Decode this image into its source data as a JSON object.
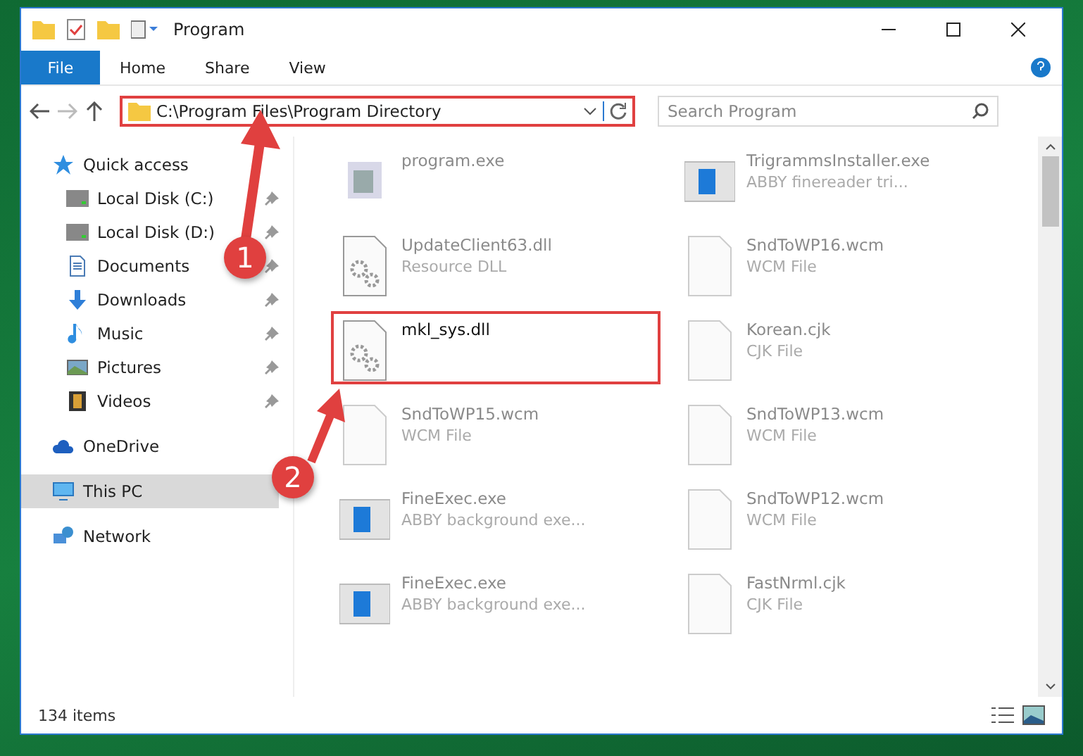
{
  "window": {
    "title": "Program"
  },
  "ribbon_tabs": [
    {
      "label": "File",
      "selected": true
    },
    {
      "label": "Home",
      "selected": false
    },
    {
      "label": "Share",
      "selected": false
    },
    {
      "label": "View",
      "selected": false
    }
  ],
  "address_bar": {
    "path": "C:\\Program Files\\Program Directory",
    "highlighted": true
  },
  "search": {
    "placeholder": "Search Program"
  },
  "sidebar": {
    "items": [
      {
        "label": "Quick access",
        "kind": "star",
        "pinned": false,
        "selected": false,
        "children": [
          {
            "label": "Local Disk (C:)",
            "kind": "drive",
            "pinned": true,
            "selected": false
          },
          {
            "label": "Local Disk (D:)",
            "kind": "drive",
            "pinned": true,
            "selected": false
          },
          {
            "label": "Documents",
            "kind": "documents",
            "pinned": true,
            "selected": false
          },
          {
            "label": "Downloads",
            "kind": "downloads",
            "pinned": true,
            "selected": false
          },
          {
            "label": "Music",
            "kind": "music",
            "pinned": true,
            "selected": false
          },
          {
            "label": "Pictures",
            "kind": "pictures",
            "pinned": true,
            "selected": false
          },
          {
            "label": "Videos",
            "kind": "videos",
            "pinned": true,
            "selected": false
          }
        ]
      },
      {
        "label": "OneDrive",
        "kind": "cloud",
        "pinned": false,
        "selected": false
      },
      {
        "label": "This PC",
        "kind": "pc",
        "pinned": false,
        "selected": true
      },
      {
        "label": "Network",
        "kind": "network",
        "pinned": false,
        "selected": false
      }
    ]
  },
  "files": [
    {
      "name": "program.exe",
      "kind": "program",
      "highlighted": false
    },
    {
      "name": "TrigrammsInstaller.exe",
      "type": "ABBY finereader tri...",
      "kind": "app",
      "highlighted": false
    },
    {
      "name": "UpdateClient63.dll",
      "type": "Resource DLL",
      "kind": "dll",
      "highlighted": false
    },
    {
      "name": "SndToWP16.wcm",
      "type": "WCM File",
      "kind": "document",
      "highlighted": false
    },
    {
      "name": "mkl_sys.dll",
      "kind": "dll",
      "highlighted": true
    },
    {
      "name": "Korean.cjk",
      "type": "CJK File",
      "kind": "document",
      "highlighted": false
    },
    {
      "name": "SndToWP15.wcm",
      "type": "WCM File",
      "kind": "document",
      "highlighted": false
    },
    {
      "name": "SndToWP13.wcm",
      "type": "WCM File",
      "kind": "document",
      "highlighted": false
    },
    {
      "name": "FineExec.exe",
      "type": "ABBY background exe...",
      "kind": "app",
      "highlighted": false
    },
    {
      "name": "SndToWP12.wcm",
      "type": "WCM File",
      "kind": "document",
      "highlighted": false
    },
    {
      "name": "FineExec.exe",
      "type": "ABBY background exe...",
      "kind": "app",
      "highlighted": false
    },
    {
      "name": "FastNrml.cjk",
      "type": "CJK File",
      "kind": "document",
      "highlighted": false
    }
  ],
  "callouts": [
    "1",
    "2"
  ],
  "status_bar": {
    "count": "134 items"
  }
}
